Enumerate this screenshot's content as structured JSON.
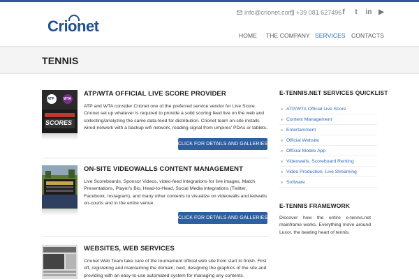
{
  "header": {
    "logo_text": "Crionet",
    "email": "info@crionet.com",
    "phone": "+39 081 627496",
    "socials": [
      {
        "icon": "facebook-icon",
        "glyph": "f"
      },
      {
        "icon": "twitter-icon",
        "glyph": "t"
      },
      {
        "icon": "linkedin-icon",
        "glyph": "in"
      },
      {
        "icon": "youtube-icon",
        "glyph": "▶"
      }
    ]
  },
  "nav": {
    "items": [
      {
        "label": "HOME"
      },
      {
        "label": "THE COMPANY"
      },
      {
        "label": "SERVICES"
      },
      {
        "label": "CONTACTS"
      }
    ],
    "active_index": 2
  },
  "page": {
    "title": "TENNIS"
  },
  "services": [
    {
      "title": "ATP/WTA OFFICIAL LIVE SCORE PROVIDER",
      "description": "ATP and WTA consider Crionet one of the preferred service vendor for Live Score. Crionet set up whatever is required to provide a solid scoring feed live on the web and collecting/analyzing the same data-feed for distribution. Crionet team on-site installs wired-network with a backup wifi network, reading signal from umpires' PDAs or tablets.",
      "button": "CLICK FOR DETAILS AND GALLERIES",
      "thumb_labels": [
        "ATP",
        "WTA",
        "SCORES"
      ]
    },
    {
      "title": "ON-SITE VIDEOWALLS CONTENT MANAGEMENT",
      "description": "Live Scoreboards, Sponsor Videos, video-feed integrations for live images, Match Presentations, Player's Bio, Head-to-Head, Social Media Integrations (Twitter, Facebook, Instagram), and many other contents to visualize on videowalls and ledwalls on-courts and in the entire venue.",
      "button": "CLICK FOR DETAILS AND GALLERIES"
    },
    {
      "title": "WEBSITES, WEB SERVICES",
      "description": "Crionet Web Team take care of the tournament official web site from start to finish. First off, registering and maintaining the domain; next, designing the graphics of the site and providing with an easy-to-use automated system for managing any contents. Tournament"
    }
  ],
  "sidebar": {
    "quicklist_heading": "E-TENNIS.NET SERVICES QUICKLIST",
    "quicklist": [
      {
        "label": "ATP/WTA Official Live Score"
      },
      {
        "label": "Content Management"
      },
      {
        "label": "Entertainment"
      },
      {
        "label": "Official Website"
      },
      {
        "label": "Official Mobile App"
      },
      {
        "label": "Videowalls, Scoreboard Renting"
      },
      {
        "label": "Video Production, Live Streaming"
      },
      {
        "label": "Software"
      }
    ],
    "framework_heading": "E-TENNIS FRAMEWORK",
    "framework_text": "Discover how the entire e-tennis.net mainframe works. Everything move around Luxor, the beating heart of tennis."
  },
  "colors": {
    "brand": "#1f4f8f",
    "accent": "#2d6bb5",
    "button": "#2e5f9e"
  }
}
